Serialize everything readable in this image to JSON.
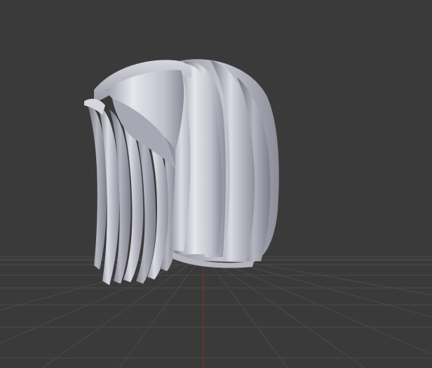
{
  "viewport": {
    "background_color": "#3a3a3a",
    "grid_color": "#4d4d4d",
    "grid_line_color_light": "#555555",
    "z_axis_color": "#7a2e2e",
    "model_base_color": "#b9bac4",
    "model_highlight_color": "#e3e4ea",
    "model_shadow_color": "#7e7f8c"
  }
}
